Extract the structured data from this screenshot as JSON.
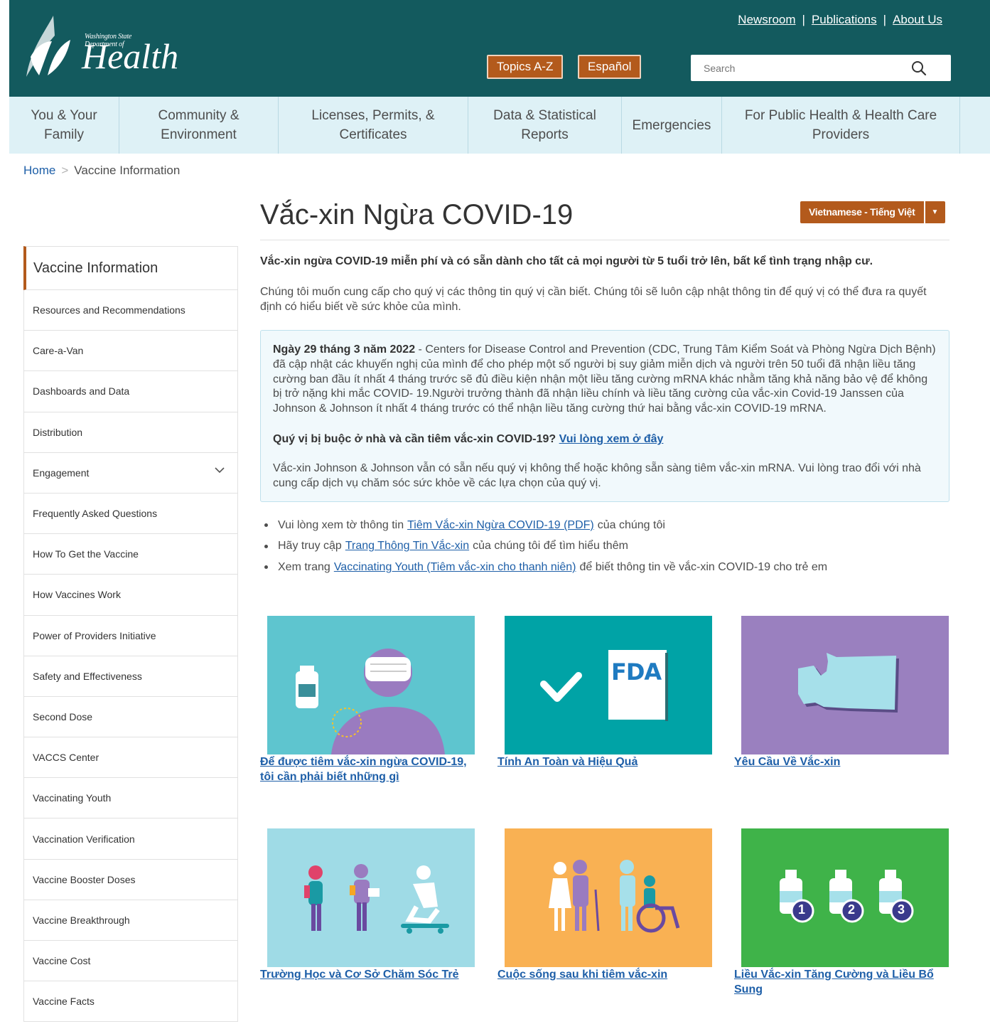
{
  "header": {
    "logo_tagline": "Washington State Department of",
    "logo_word": "Health",
    "utility_links": [
      "Newsroom",
      "Publications",
      "About Us"
    ],
    "topics_button": "Topics A-Z",
    "espanol_button": "Español",
    "search_placeholder": "Search"
  },
  "nav": [
    "You & Your Family",
    "Community & Environment",
    "Licenses, Permits, & Certificates",
    "Data & Statistical Reports",
    "Emergencies",
    "For Public Health & Health Care Providers"
  ],
  "breadcrumb": {
    "home": "Home",
    "current": "Vaccine Information"
  },
  "sidebar": {
    "heading": "Vaccine Information",
    "items": [
      "Resources and Recommendations",
      "Care-a-Van",
      "Dashboards and Data",
      "Distribution",
      "Engagement",
      "Frequently Asked Questions",
      "How To Get the Vaccine",
      "How Vaccines Work",
      "Power of Providers Initiative",
      "Safety and Effectiveness",
      "Second Dose",
      "VACCS Center",
      "Vaccinating Youth",
      "Vaccination Verification",
      "Vaccine Booster Doses",
      "Vaccine Breakthrough",
      "Vaccine Cost",
      "Vaccine Facts"
    ]
  },
  "main": {
    "title": "Vắc-xin Ngừa COVID-19",
    "language_selector": "Vietnamese - Tiếng Việt",
    "lead": "Vắc-xin ngừa COVID-19 miễn phí và có sẵn dành cho tất cả mọi người từ 5 tuổi trở lên, bất kể tình trạng nhập cư.",
    "intro": "Chúng tôi muốn cung cấp cho quý vị các thông tin quý vị cần biết. Chúng tôi sẽ luôn cập nhật thông tin để quý vị có thể đưa ra quyết định có hiểu biết về sức khỏe của mình.",
    "alert": {
      "date": "Ngày 29 tháng 3 năm 2022",
      "body": " - Centers for Disease Control and Prevention (CDC, Trung Tâm Kiểm Soát và Phòng Ngừa Dịch Bệnh) đã cập nhật các khuyến nghị của mình để cho phép một số người bị suy giảm miễn dịch và người trên 50 tuổi đã nhận liều tăng cường ban đầu ít nhất 4 tháng trước sẽ đủ điều kiện nhận một liều tăng cường mRNA khác nhằm tăng khả năng bảo vệ để không bị trở nặng khi mắc COVID- 19.Người trưởng thành đã nhận liều chính và liều tăng cường của vắc-xin Covid-19 Janssen của Johnson & Johnson ít nhất 4 tháng trước có thể nhận liều tăng cường thứ hai bằng vắc-xin COVID-19 mRNA.",
      "question": "Quý vị bị buộc ở nhà và cần tiêm vắc-xin COVID-19?",
      "question_link": "Vui lòng xem ở đây",
      "jj": "Vắc-xin Johnson & Johnson vẫn có sẵn nếu quý vị không thể hoặc không sẵn sàng tiêm vắc-xin mRNA. Vui lòng trao đổi với nhà cung cấp dịch vụ chăm sóc sức khỏe về các lựa chọn của quý vị."
    },
    "bullets": [
      {
        "pre": "Vui lòng xem tờ thông tin",
        "link": "Tiêm Vắc-xin Ngừa COVID-19 (PDF)",
        "post": "của chúng tôi"
      },
      {
        "pre": "Hãy truy cập",
        "link": "Trang Thông Tin Vắc-xin",
        "post": "của chúng tôi để tìm hiểu thêm"
      },
      {
        "pre": "Xem trang",
        "link": "Vaccinating Youth (Tiêm vắc-xin cho thanh niên)",
        "post": "để biết thông tin về vắc-xin COVID-19 cho trẻ em"
      }
    ],
    "cards": [
      {
        "caption": "Để được tiêm vắc-xin ngừa COVID-19, tôi cần phải biết những gì",
        "color": "#5ec5cf"
      },
      {
        "caption": "Tính An Toàn và Hiệu Quả",
        "color": "#00a3a6",
        "fda": "FDA"
      },
      {
        "caption": "Yêu Cầu Về Vắc-xin",
        "color": "#9a80bf"
      },
      {
        "caption": "Trường Học và Cơ Sở Chăm Sóc Trẻ",
        "color": "#9fdbe6"
      },
      {
        "caption": "Cuộc sống sau khi tiêm vắc-xin",
        "color": "#f9b153"
      },
      {
        "caption": "Liều Vắc-xin Tăng Cường và Liều Bổ Sung",
        "color": "#3fb349",
        "doses": [
          "1",
          "2",
          "3"
        ]
      }
    ]
  }
}
